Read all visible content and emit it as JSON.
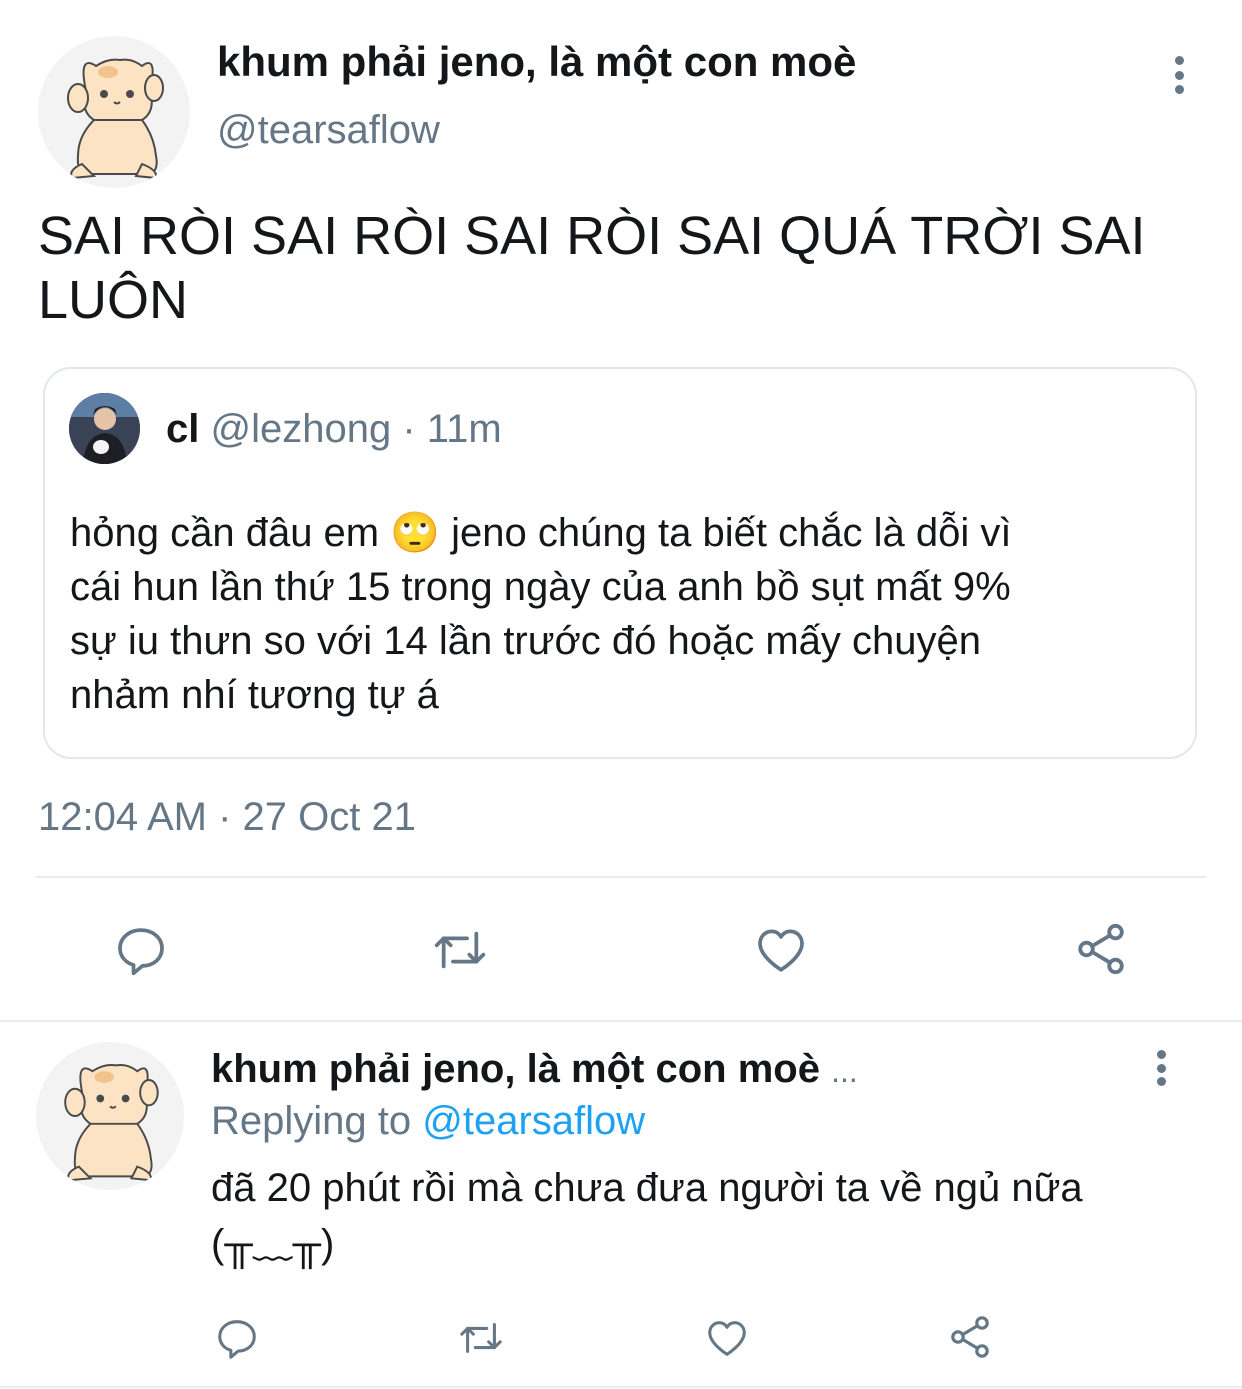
{
  "tweet": {
    "author_name": "khum phải jeno, là một con moè",
    "author_handle": "@tearsaflow",
    "avatar_icon": "cat-avatar",
    "text": "SAI RÒI SAI RÒI SAI RÒI SAI QUÁ TRỜI SAI LUÔN",
    "timestamp": "12:04 AM · 27 Oct 21",
    "actions": {
      "reply_icon": "comment-icon",
      "retweet_icon": "retweet-icon",
      "like_icon": "heart-icon",
      "share_icon": "share-icon"
    }
  },
  "quoted_tweet": {
    "author_name": "cl",
    "author_handle": "@lezhong",
    "separator": "·",
    "age": "11m",
    "text_lines": [
      "hỏng cần đâu em 🙄 jeno chúng ta biết chắc là dỗi vì",
      "cái hun lần thứ 15 trong ngày của anh bồ sụt mất 9%",
      "sự iu thưn so với 14 lần trước đó hoặc mấy chuyện",
      "nhảm nhí tương tự á"
    ]
  },
  "reply": {
    "author_name": "khum phải jeno, là một con moè",
    "ellipsis": "...",
    "replying_to_label": "Replying to",
    "replying_to_handle": "@tearsaflow",
    "text_lines": [
      "đã 20 phút rồi mà chưa đưa người ta về ngủ nữa",
      "(╥﹏╥)"
    ]
  },
  "colors": {
    "text": "#14171a",
    "secondary": "#657786",
    "link": "#1da1f2",
    "border": "#e1e8ed"
  }
}
